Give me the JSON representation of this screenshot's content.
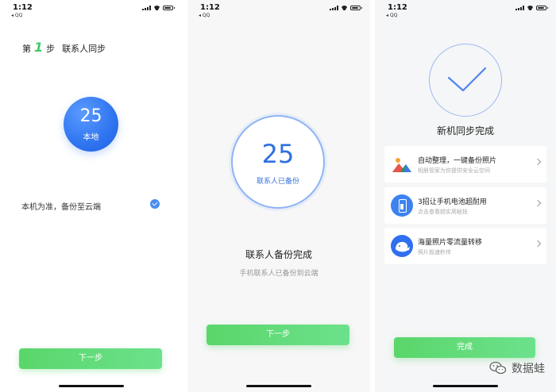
{
  "status_bar": {
    "time": "1:12",
    "back_app": "◂ QQ"
  },
  "screen1": {
    "step_prefix": "第",
    "step_number": "1",
    "step_suffix": "步",
    "step_title": "联系人同步",
    "count": "25",
    "count_label": "本地",
    "option_label": "本机为准，备份至云端",
    "option_checked": true,
    "next_button": "下一步"
  },
  "screen2": {
    "count": "25",
    "count_label": "联系人已备份",
    "title": "联系人备份完成",
    "subtitle": "手机联系人已备份到云端",
    "next_button": "下一步"
  },
  "screen3": {
    "title": "新机同步完成",
    "cards": [
      {
        "title": "自动整理，一键备份照片",
        "subtitle": "相册管家为你提供安全云空间",
        "icon": "photo-mountain-icon"
      },
      {
        "title": "3招让手机电池超耐用",
        "subtitle": "点击查看超实用秘技",
        "icon": "battery-icon"
      },
      {
        "title": "海量照片零流量转移",
        "subtitle": "照片极速秒传",
        "icon": "whale-icon"
      }
    ],
    "done_button": "完成"
  },
  "watermark": {
    "text": "数据蛙"
  },
  "colors": {
    "accent_green": "#5ad66a",
    "accent_blue": "#2f74f0",
    "ring_blue": "#8fb4f5"
  }
}
